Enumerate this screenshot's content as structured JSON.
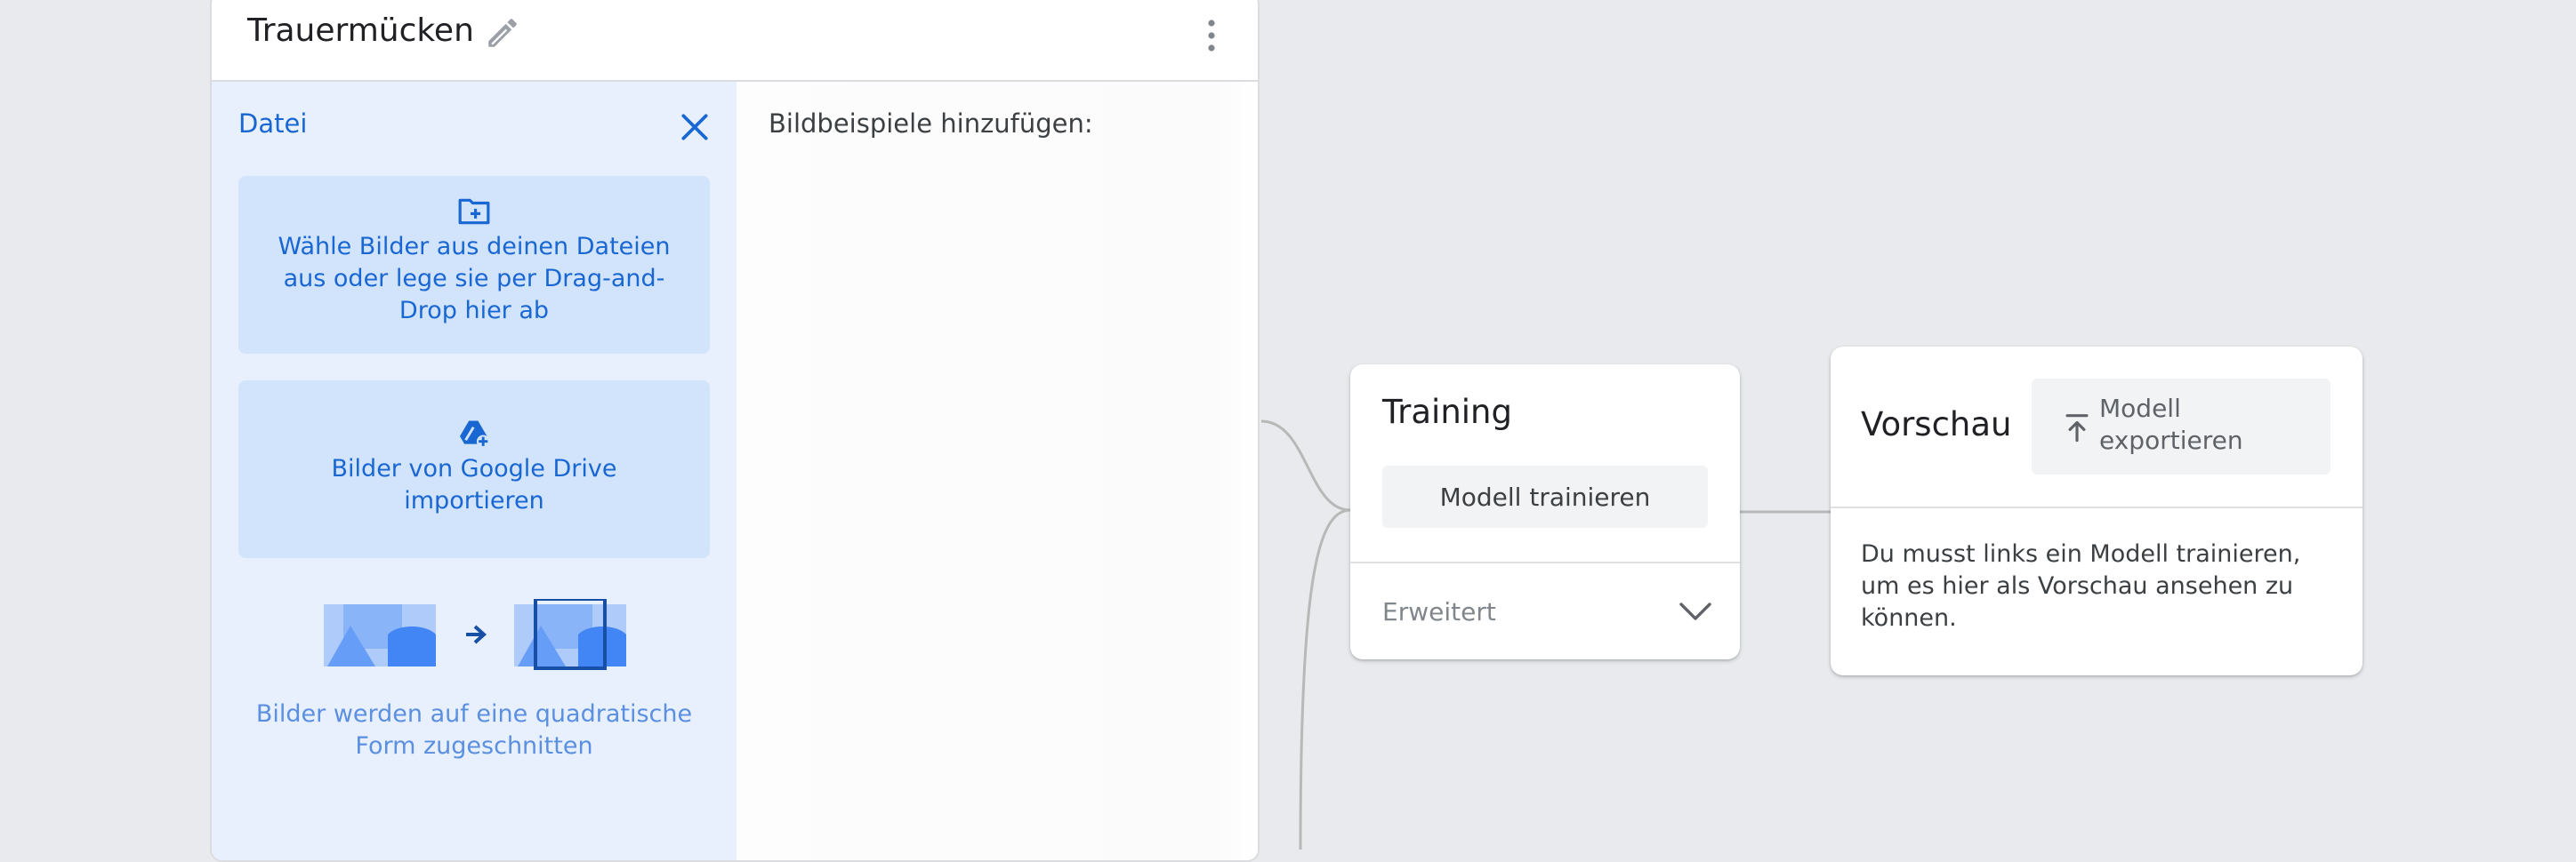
{
  "class_card": {
    "title": "Trauermücken",
    "upload_panel": {
      "label": "Datei",
      "files_button": "Wähle Bilder aus deinen Dateien aus oder lege sie per Drag-and-Drop hier ab",
      "drive_button": "Bilder von Google Drive importieren",
      "crop_note": "Bilder werden auf eine quadratische Form zugeschnitten"
    },
    "samples_label": "Bildbeispiele hinzufügen:"
  },
  "training": {
    "title": "Training",
    "train_button": "Modell trainieren",
    "advanced_label": "Erweitert"
  },
  "preview": {
    "title": "Vorschau",
    "export_button": "Modell exportieren",
    "message": "Du musst links ein Modell trainieren, um es hier als Vorschau ansehen zu können."
  },
  "icons": {
    "edit": "pencil-icon",
    "more": "more-vert-icon",
    "close": "close-icon",
    "folder": "folder-add-icon",
    "drive": "google-drive-add-icon",
    "chevron": "chevron-down-icon",
    "export": "upload-icon"
  },
  "colors": {
    "accent": "#1967d2",
    "panel_bg": "#e8f0fe",
    "button_bg": "#d2e3fc",
    "page_bg": "#e8eaed"
  }
}
